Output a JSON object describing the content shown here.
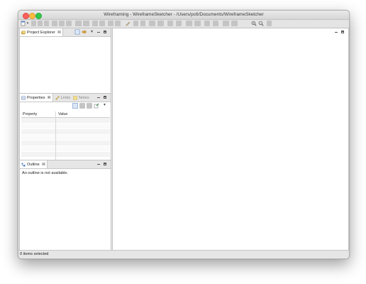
{
  "window": {
    "title": "Wireframing - WireframeSketcher - /Users/pc6/Documents/WireframeSketcher"
  },
  "views": {
    "project_explorer": {
      "tab_label": "Project Explorer",
      "close_glyph": "⌘"
    },
    "properties": {
      "tabs": [
        {
          "label": "Properties",
          "active": true
        },
        {
          "label": "Links",
          "active": false
        },
        {
          "label": "Notes",
          "active": false
        }
      ],
      "columns": [
        "Property",
        "Value"
      ],
      "row_count": 7
    },
    "outline": {
      "tab_label": "Outline",
      "message": "An outline is not available."
    }
  },
  "status_bar": {
    "text": "0 items selected"
  },
  "colors": {
    "close": "#fc605c",
    "minimize": "#fdbc40",
    "maximize": "#34c84a",
    "selection": "#dbe7f8"
  },
  "icons": {
    "project_explorer_tab": "folders-icon",
    "collapse_all": "collapse-all-icon",
    "link_editor": "link-editor-icon",
    "zoom_in": "zoom-in-icon",
    "zoom_out": "zoom-out-icon"
  }
}
